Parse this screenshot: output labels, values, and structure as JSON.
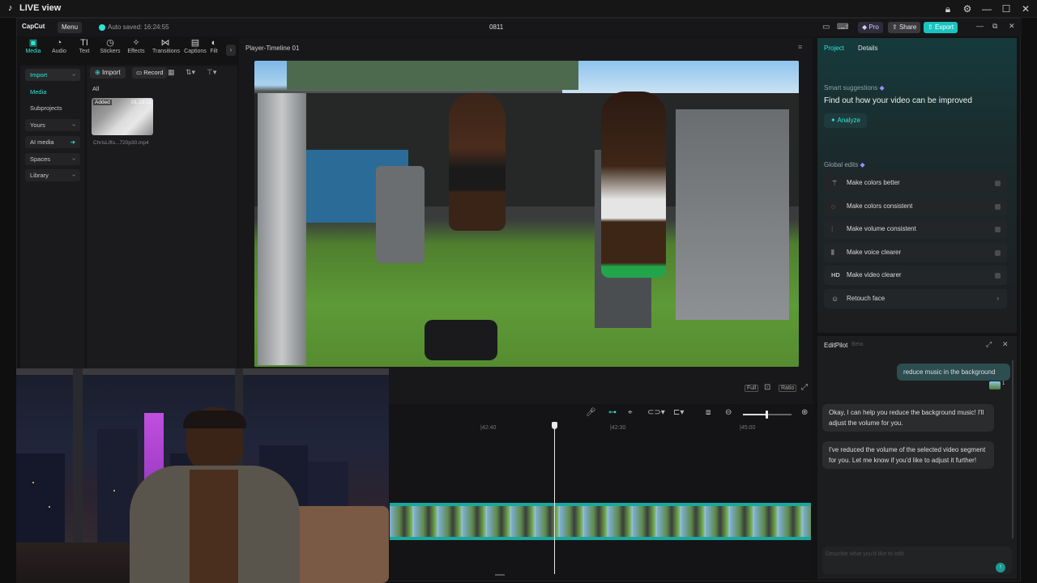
{
  "os": {
    "title": "LIVE view"
  },
  "app": {
    "brand": "CapCut",
    "menu_label": "Menu",
    "autosave": "Auto saved: 16:24:55",
    "project_name": "0811",
    "pro_label": "Pro",
    "share_label": "Share",
    "export_label": "Export"
  },
  "toolbar": {
    "items": [
      {
        "label": "Media",
        "icon": "media-icon"
      },
      {
        "label": "Audio",
        "icon": "audio-icon"
      },
      {
        "label": "Text",
        "icon": "text-icon"
      },
      {
        "label": "Stickers",
        "icon": "stickers-icon"
      },
      {
        "label": "Effects",
        "icon": "effects-icon"
      },
      {
        "label": "Transitions",
        "icon": "transitions-icon"
      },
      {
        "label": "Captions",
        "icon": "captions-icon"
      },
      {
        "label": "Filt",
        "icon": "filters-icon"
      }
    ]
  },
  "leftnav": {
    "items": [
      "Import",
      "Media",
      "Subprojects",
      "Yours",
      "AI media",
      "Spaces",
      "Library"
    ]
  },
  "media": {
    "import_label": "Import",
    "record_label": "Record",
    "filter_all": "All",
    "clip": {
      "badge": "Added",
      "duration": "01:23:11",
      "filename": "ChrisLifts...720p30.mp4"
    }
  },
  "player": {
    "title": "Player-Timeline 01",
    "btn_full": "Full",
    "btn_ratio": "Ratio"
  },
  "timeline": {
    "ticks": [
      "|42:40",
      "|42:30",
      "|45:00"
    ]
  },
  "right": {
    "tab_project": "Project",
    "tab_details": "Details",
    "smart_title": "Smart suggestions",
    "smart_headline": "Find out how your video can be improved",
    "analyze_label": "Analyze",
    "global_title": "Global edits",
    "edits": [
      {
        "label": "Make colors better",
        "icon": "wand-icon"
      },
      {
        "label": "Make colors consistent",
        "icon": "palette-icon"
      },
      {
        "label": "Make volume consistent",
        "icon": "sliders-icon"
      },
      {
        "label": "Make voice clearer",
        "icon": "waveform-icon"
      },
      {
        "label": "Make video clearer",
        "icon": "hd-icon"
      },
      {
        "label": "Retouch face",
        "icon": "face-icon"
      }
    ]
  },
  "chat": {
    "title": "EditPilot",
    "beta": "Beta",
    "user_msg": "reduce music in the background",
    "bot_msg_1": "Okay, I can help you reduce the background music! I'll adjust the volume for you.",
    "bot_msg_2": "I've reduced the volume of the selected video segment for you. Let me know if you'd like to adjust it further!",
    "input_placeholder": "Describe what you'd like to edit"
  },
  "colors": {
    "accent": "#2ee6d6",
    "export": "#19c3c0",
    "panel": "#1b1b1d"
  }
}
